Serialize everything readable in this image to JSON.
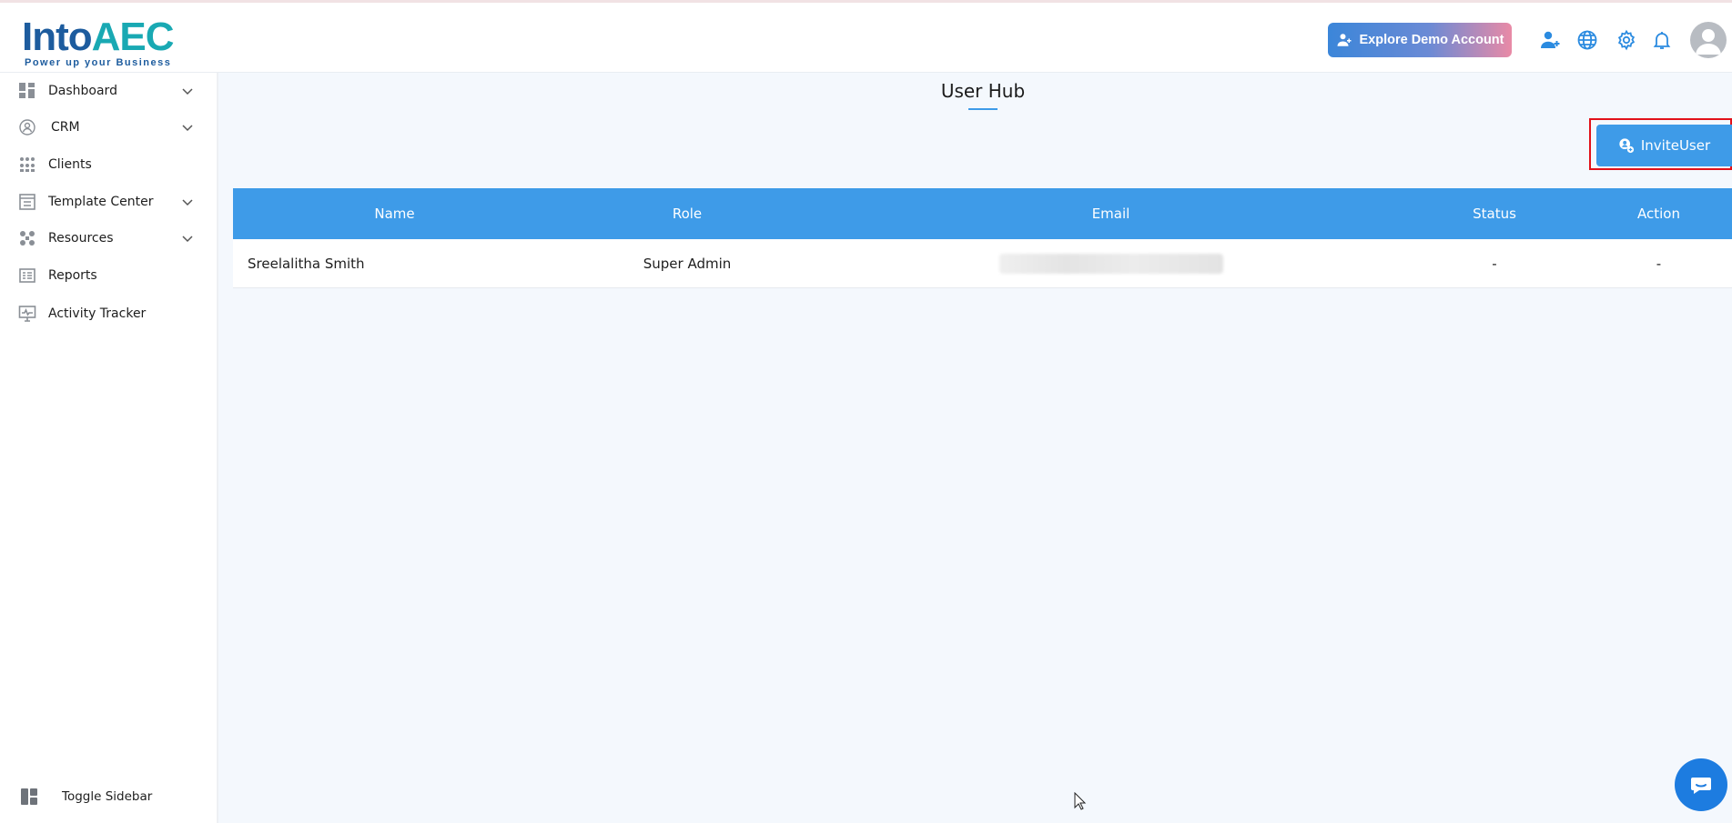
{
  "brand": {
    "logo_main": "Into",
    "logo_accent": "AEC",
    "tagline": "Power up your Business"
  },
  "header": {
    "demo_button_label": "Explore Demo Account",
    "icons": [
      "add-user-icon",
      "globe-icon",
      "gear-icon",
      "bell-icon",
      "avatar"
    ]
  },
  "sidebar": {
    "items": [
      {
        "label": "Dashboard",
        "icon": "dashboard-icon",
        "expandable": true
      },
      {
        "label": "CRM",
        "icon": "crm-icon",
        "expandable": true
      },
      {
        "label": "Clients",
        "icon": "clients-icon",
        "expandable": false
      },
      {
        "label": "Template Center",
        "icon": "template-icon",
        "expandable": true
      },
      {
        "label": "Resources",
        "icon": "resources-icon",
        "expandable": true
      },
      {
        "label": "Reports",
        "icon": "reports-icon",
        "expandable": false
      },
      {
        "label": "Activity Tracker",
        "icon": "activity-icon",
        "expandable": false
      }
    ],
    "toggle_label": "Toggle Sidebar"
  },
  "main": {
    "title": "User Hub",
    "invite_button_label": "InviteUser",
    "table": {
      "columns": [
        "Name",
        "Role",
        "Email",
        "Status",
        "Action"
      ],
      "rows": [
        {
          "name": "Sreelalitha Smith",
          "role": "Super Admin",
          "email": "",
          "status": "-",
          "action": "-"
        }
      ]
    }
  },
  "colors": {
    "primary": "#3e9be8",
    "brand_blue": "#1d5c9e",
    "brand_teal": "#19a9b3",
    "highlight_border": "#e1111a",
    "chat": "#1d7ce0"
  }
}
